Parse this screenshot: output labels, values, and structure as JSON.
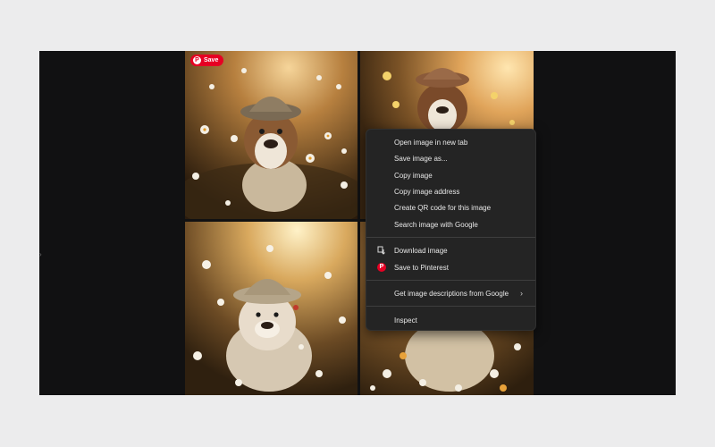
{
  "overlay": {
    "save_label": "Save",
    "pin_glyph": "P",
    "accent_color": "#e60023"
  },
  "context_menu": {
    "items": [
      {
        "label": "Open image in new tab"
      },
      {
        "label": "Save image as..."
      },
      {
        "label": "Copy image"
      },
      {
        "label": "Copy image address"
      },
      {
        "label": "Create QR code for this image"
      },
      {
        "label": "Search image with Google"
      },
      {
        "label": "Download image",
        "icon": "download-icon"
      },
      {
        "label": "Save to Pinterest",
        "icon": "pinterest-icon"
      },
      {
        "label": "Get image descriptions from Google",
        "submenu": true,
        "submenu_glyph": "›"
      },
      {
        "label": "Inspect"
      }
    ]
  },
  "images": [
    {
      "name": "bulldog-in-hat-daisies"
    },
    {
      "name": "bulldog-in-hat-sunlight"
    },
    {
      "name": "bulldog-in-cap-meadow"
    },
    {
      "name": "bulldog-in-flowers"
    }
  ]
}
